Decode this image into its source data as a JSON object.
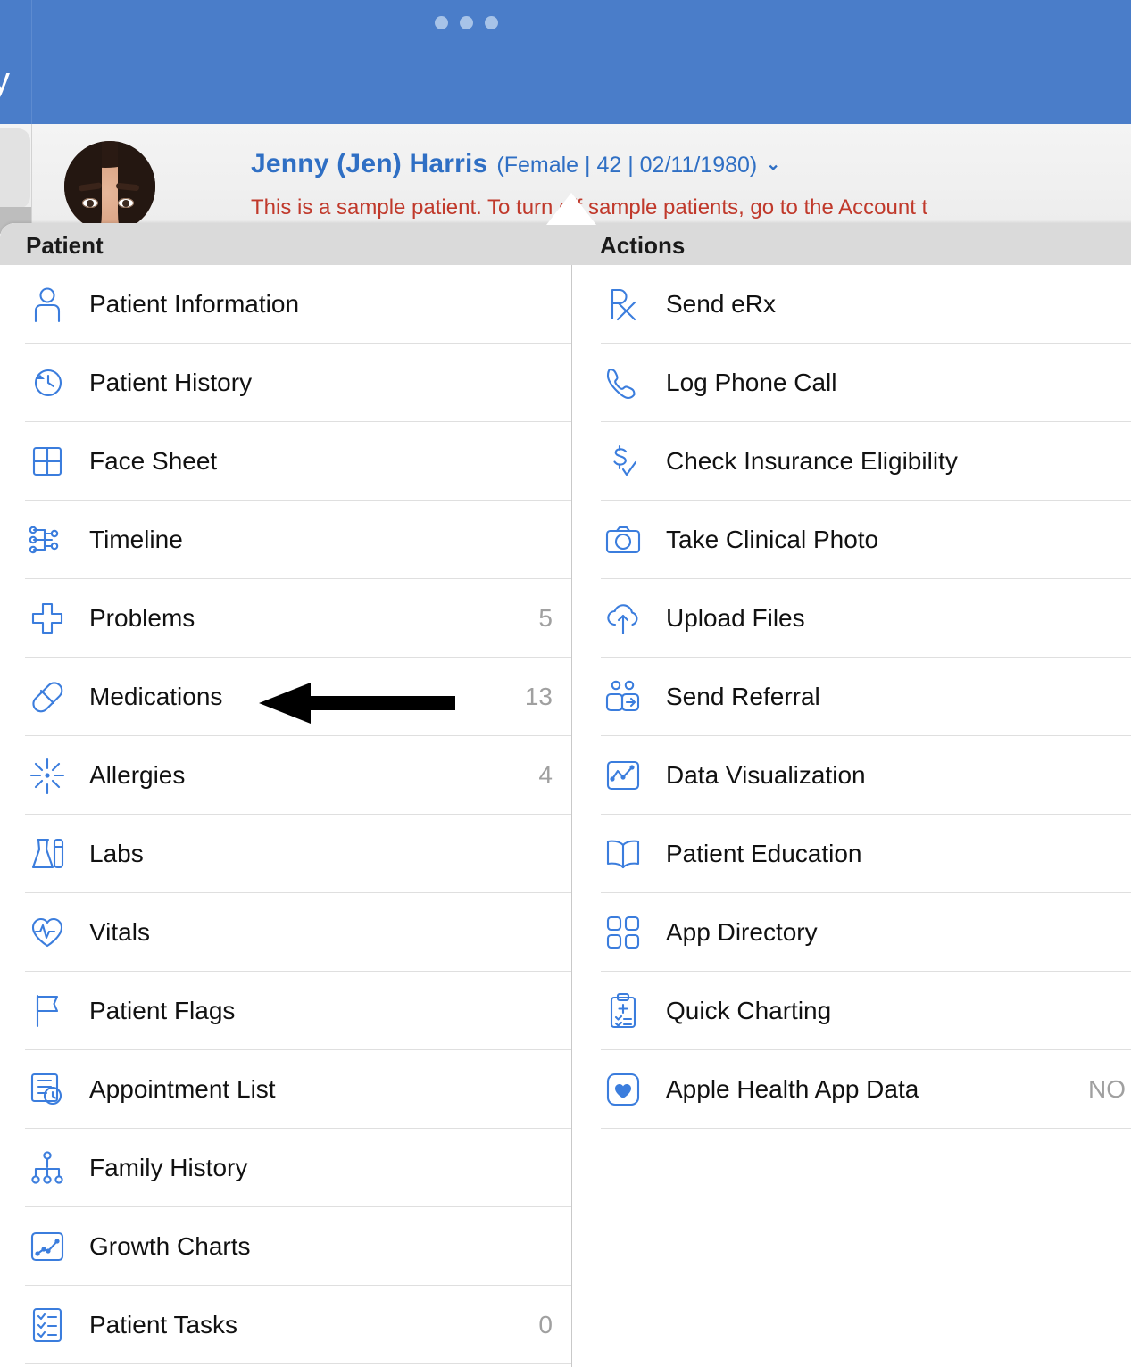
{
  "navbar": {
    "accent_color": "#4a7dc9",
    "dot_color": "#a7c3e8",
    "overflow_dots_label": "•••",
    "edge_glyph": "y"
  },
  "patient_header": {
    "name": "Jenny (Jen) Harris",
    "demographics": "(Female | 42 | 02/11/1980)",
    "caret": "⌄",
    "sample_notice": "This is a sample patient. To turn off sample patients, go to the Account t",
    "name_color": "#2f6fc4",
    "notice_color": "#c0392b",
    "avatar_name": "patient-avatar"
  },
  "popover": {
    "columns": [
      {
        "header": "Patient",
        "items": [
          {
            "label": "Patient Information",
            "icon": "person-icon",
            "count": ""
          },
          {
            "label": "Patient History",
            "icon": "clock-rewind-icon",
            "count": ""
          },
          {
            "label": "Face Sheet",
            "icon": "grid-four-icon",
            "count": ""
          },
          {
            "label": "Timeline",
            "icon": "timeline-icon",
            "count": ""
          },
          {
            "label": "Problems",
            "icon": "medical-cross-icon",
            "count": "5"
          },
          {
            "label": "Medications",
            "icon": "pill-capsule-icon",
            "count": "13"
          },
          {
            "label": "Allergies",
            "icon": "allergy-burst-icon",
            "count": "4"
          },
          {
            "label": "Labs",
            "icon": "lab-flask-icon",
            "count": ""
          },
          {
            "label": "Vitals",
            "icon": "heart-pulse-icon",
            "count": ""
          },
          {
            "label": "Patient Flags",
            "icon": "flag-icon",
            "count": ""
          },
          {
            "label": "Appointment List",
            "icon": "appointment-list-icon",
            "count": ""
          },
          {
            "label": "Family History",
            "icon": "family-tree-icon",
            "count": ""
          },
          {
            "label": "Growth Charts",
            "icon": "growth-chart-icon",
            "count": ""
          },
          {
            "label": "Patient Tasks",
            "icon": "task-checklist-icon",
            "count": "0"
          }
        ]
      },
      {
        "header": "Actions",
        "items": [
          {
            "label": "Send eRx",
            "icon": "rx-icon",
            "count": ""
          },
          {
            "label": "Log Phone Call",
            "icon": "phone-icon",
            "count": ""
          },
          {
            "label": "Check Insurance Eligibility",
            "icon": "dollar-check-icon",
            "count": ""
          },
          {
            "label": "Take Clinical Photo",
            "icon": "camera-icon",
            "count": ""
          },
          {
            "label": "Upload Files",
            "icon": "cloud-upload-icon",
            "count": ""
          },
          {
            "label": "Send Referral",
            "icon": "send-referral-icon",
            "count": ""
          },
          {
            "label": "Data Visualization",
            "icon": "data-viz-icon",
            "count": ""
          },
          {
            "label": "Patient Education",
            "icon": "book-open-icon",
            "count": ""
          },
          {
            "label": "App Directory",
            "icon": "app-grid-icon",
            "count": ""
          },
          {
            "label": "Quick Charting",
            "icon": "clipboard-icon",
            "count": ""
          },
          {
            "label": "Apple Health App Data",
            "icon": "heart-square-icon",
            "count": "NO"
          }
        ]
      }
    ],
    "icon_color": "#3b7ddd",
    "count_color": "#a0a0a0",
    "header_background": "#dadada"
  },
  "annotation": {
    "name": "pointer-arrow",
    "points_at": "Medications",
    "color": "#000000"
  }
}
